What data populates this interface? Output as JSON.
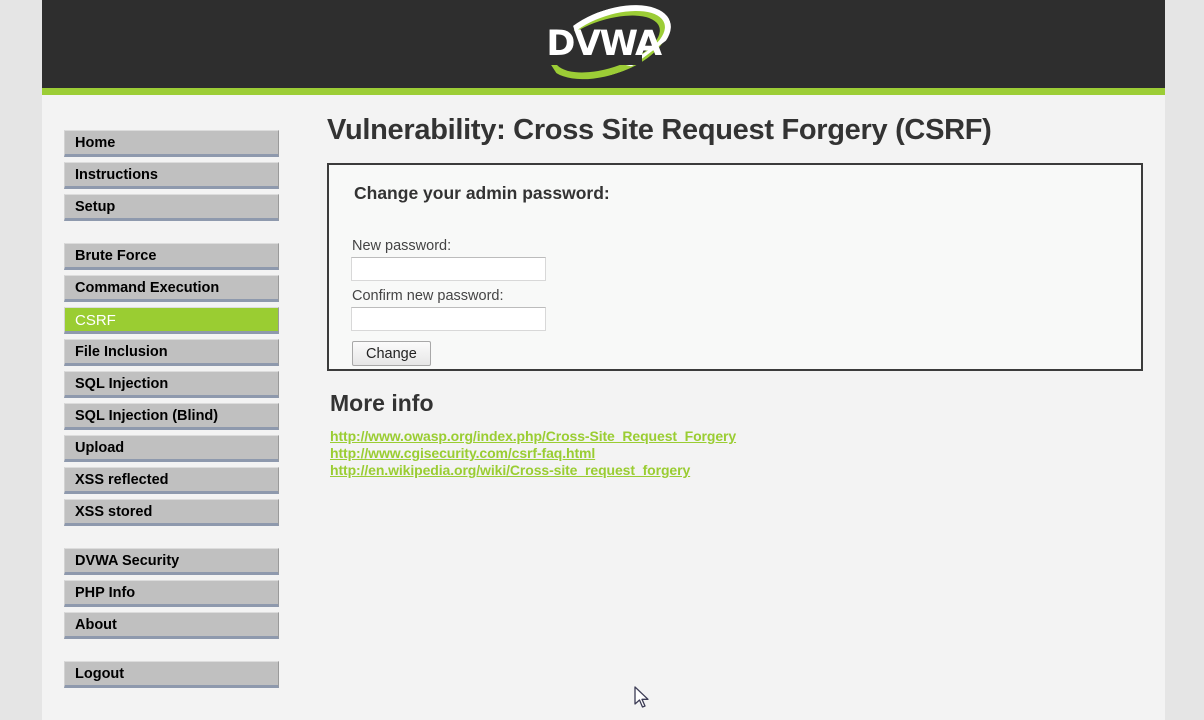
{
  "header": {
    "logo_text": "DVWA",
    "accent_green": "#9acd32",
    "bar_color": "#9ccd36",
    "background": "#2e2e2e"
  },
  "sidebar": {
    "groups": [
      {
        "items": [
          {
            "label": "Home",
            "selected": false
          },
          {
            "label": "Instructions",
            "selected": false
          },
          {
            "label": "Setup",
            "selected": false
          }
        ]
      },
      {
        "items": [
          {
            "label": "Brute Force",
            "selected": false
          },
          {
            "label": "Command Execution",
            "selected": false
          },
          {
            "label": "CSRF",
            "selected": true
          },
          {
            "label": "File Inclusion",
            "selected": false
          },
          {
            "label": "SQL Injection",
            "selected": false
          },
          {
            "label": "SQL Injection (Blind)",
            "selected": false
          },
          {
            "label": "Upload",
            "selected": false
          },
          {
            "label": "XSS reflected",
            "selected": false
          },
          {
            "label": "XSS stored",
            "selected": false
          }
        ]
      },
      {
        "items": [
          {
            "label": "DVWA Security",
            "selected": false
          },
          {
            "label": "PHP Info",
            "selected": false
          },
          {
            "label": "About",
            "selected": false
          }
        ]
      },
      {
        "items": [
          {
            "label": "Logout",
            "selected": false
          }
        ]
      }
    ]
  },
  "main": {
    "page_title": "Vulnerability: Cross Site Request Forgery (CSRF)",
    "form": {
      "heading": "Change your admin password:",
      "new_password_label": "New password:",
      "new_password_value": "",
      "confirm_password_label": "Confirm new password:",
      "confirm_password_value": "",
      "submit_label": "Change"
    },
    "more_info": {
      "title": "More info",
      "links": [
        "http://www.owasp.org/index.php/Cross-Site_Request_Forgery",
        "http://www.cgisecurity.com/csrf-faq.html",
        "http://en.wikipedia.org/wiki/Cross-site_request_forgery"
      ]
    }
  }
}
